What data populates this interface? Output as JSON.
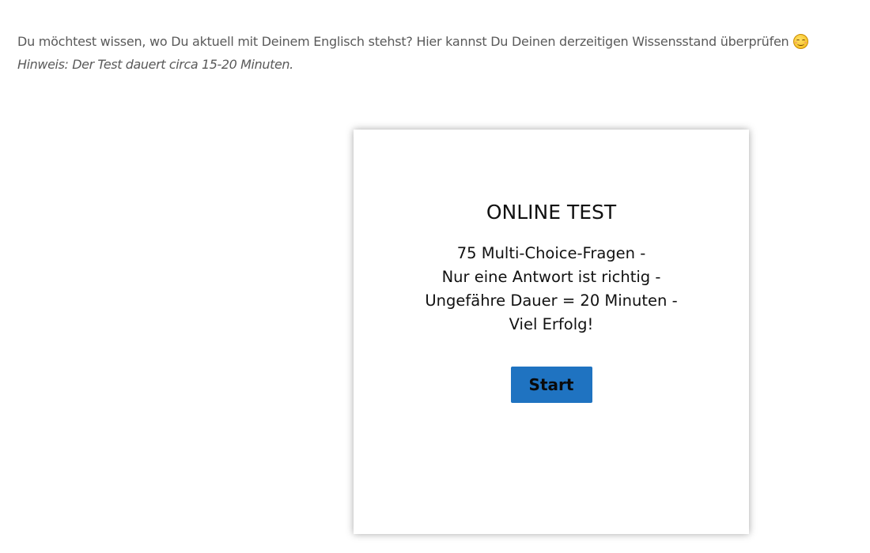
{
  "intro": {
    "text": "Du möchtest wissen, wo Du aktuell mit Deinem Englisch stehst? Hier kannst Du Deinen derzeitigen Wissensstand überprüfen",
    "emoji": "smiling-face-icon",
    "hint": "Hinweis: Der Test dauert circa 15-20 Minuten."
  },
  "card": {
    "title": "ONLINE TEST",
    "lines": [
      "75 Multi-Choice-Fragen -",
      "Nur eine Antwort ist richtig -",
      "Ungefähre Dauer = 20 Minuten -",
      "Viel Erfolg!"
    ],
    "start_label": "Start"
  },
  "colors": {
    "button": "#1f73c1",
    "intro_text": "#5a5a5a",
    "card_text": "#111111"
  }
}
